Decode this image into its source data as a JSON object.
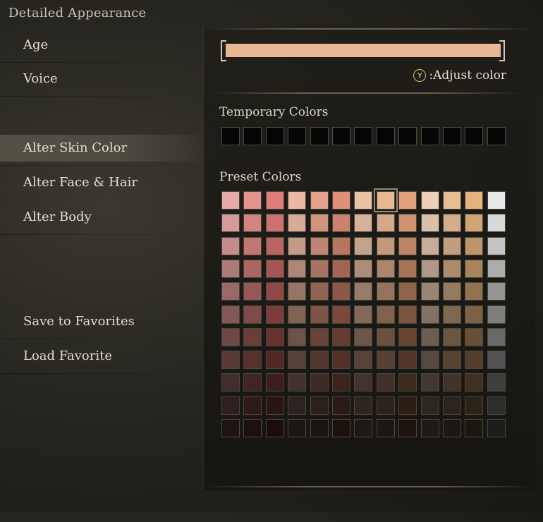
{
  "window": {
    "title": "Detailed Appearance"
  },
  "menu": {
    "items": [
      {
        "label": "Age",
        "selected": false
      },
      {
        "label": "Voice",
        "selected": false
      },
      {
        "label": "Alter Skin Color",
        "selected": true
      },
      {
        "label": "Alter Face & Hair",
        "selected": false
      },
      {
        "label": "Alter Body",
        "selected": false
      },
      {
        "label": "Save to Favorites",
        "selected": false
      },
      {
        "label": "Load Favorite",
        "selected": false
      }
    ]
  },
  "current_color": {
    "hex": "#eab795"
  },
  "adjust": {
    "button": "Y",
    "label": ":Adjust color"
  },
  "temporary": {
    "label": "Temporary Colors",
    "count": 13,
    "colors": [
      "#050505",
      "#050505",
      "#050505",
      "#050505",
      "#050505",
      "#050505",
      "#050505",
      "#050505",
      "#050505",
      "#050505",
      "#050505",
      "#050505",
      "#050505"
    ]
  },
  "preset": {
    "label": "Preset Colors",
    "selected": {
      "row": 0,
      "col": 7
    },
    "rows": [
      [
        "#e6aaa8",
        "#e4938e",
        "#df7d78",
        "#eab8a5",
        "#e5a08b",
        "#e08f79",
        "#e9c1a6",
        "#eab795",
        "#e29f7c",
        "#ecd0b8",
        "#e8be96",
        "#e5b37f",
        "#e9e9e9"
      ],
      [
        "#d69a99",
        "#d28480",
        "#cc716d",
        "#d7ab98",
        "#d0947f",
        "#cb836d",
        "#d6b29a",
        "#d6a889",
        "#cf9271",
        "#d8c0a9",
        "#d4ae8a",
        "#d1a474",
        "#d8d8d8"
      ],
      [
        "#c48b8a",
        "#c07773",
        "#bb6461",
        "#c49b88",
        "#bd8572",
        "#b87662",
        "#c3a38b",
        "#c3987b",
        "#bc8465",
        "#c5ad99",
        "#c19f7e",
        "#be9569",
        "#c4c4c4"
      ],
      [
        "#af7978",
        "#aa6663",
        "#a65652",
        "#ae8776",
        "#a87362",
        "#a26553",
        "#ad8f79",
        "#ad856a",
        "#a67356",
        "#af9886",
        "#ab8c6d",
        "#a8835b",
        "#adadad"
      ],
      [
        "#996867",
        "#945855",
        "#904946",
        "#977566",
        "#926354",
        "#8d5747",
        "#977d69",
        "#96735c",
        "#916449",
        "#988574",
        "#947a5e",
        "#92724f",
        "#959595"
      ],
      [
        "#845857",
        "#804a48",
        "#7b3d3b",
        "#826457",
        "#7d5447",
        "#794a3c",
        "#82695a",
        "#81624e",
        "#7c553e",
        "#837163",
        "#7f684f",
        "#7e6143",
        "#7e7e7e"
      ],
      [
        "#6e4847",
        "#6a3d3b",
        "#673230",
        "#6c5248",
        "#68453a",
        "#643c31",
        "#6c564a",
        "#6b5040",
        "#674533",
        "#6d5c51",
        "#6a5541",
        "#684f37",
        "#686868"
      ],
      [
        "#583938",
        "#55302f",
        "#522827",
        "#57413a",
        "#53372f",
        "#503027",
        "#56443b",
        "#563f33",
        "#523729",
        "#574941",
        "#554334",
        "#533f2c",
        "#535353"
      ],
      [
        "#432c2b",
        "#402524",
        "#3e1e1d",
        "#42312c",
        "#3f2a24",
        "#3d251e",
        "#41342d",
        "#413027",
        "#3e2a1f",
        "#423831",
        "#403327",
        "#3f3021",
        "#3f3f3f"
      ],
      [
        "#2f1f1e",
        "#2d1a19",
        "#2b1514",
        "#2e2320",
        "#2c1e19",
        "#2b1a15",
        "#2e2520",
        "#2e221c",
        "#2c1e16",
        "#2e2823",
        "#2d241c",
        "#2c2218",
        "#2d2d2d"
      ],
      [
        "#1d1413",
        "#1c1110",
        "#1b0d0d",
        "#1d1614",
        "#1c1310",
        "#1b110d",
        "#1d1814",
        "#1d1612",
        "#1c130e",
        "#1d1a17",
        "#1c1712",
        "#1c160f",
        "#1d1d1d"
      ]
    ]
  }
}
